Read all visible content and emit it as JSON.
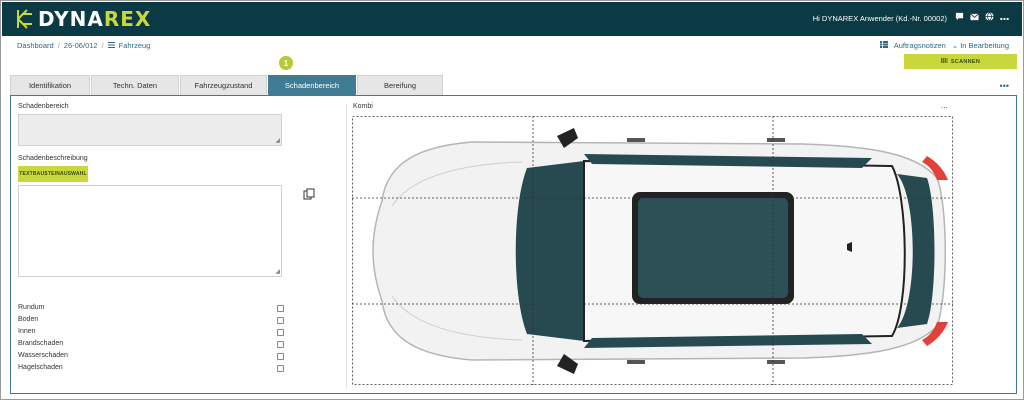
{
  "header": {
    "logo_prefix": "DYNA",
    "logo_accent": "REX",
    "greeting": "Hi DYNAREX Anwender (Kd.-Nr. 00002)",
    "icons": [
      "chat-icon",
      "mail-icon",
      "globe-icon",
      "more-icon"
    ]
  },
  "breadcrumb": {
    "home": "Dashboard",
    "order": "26-06/012",
    "current": "Fahrzeug"
  },
  "status": {
    "notes": "Auftragsnotizen",
    "state": "In Bearbeitung"
  },
  "scan_button": "SCANNEN",
  "step_badge": "1",
  "tabs": [
    {
      "label": "Identifikation",
      "active": false
    },
    {
      "label": "Techn. Daten",
      "active": false
    },
    {
      "label": "Fahrzeugzustand",
      "active": false
    },
    {
      "label": "Schadenbereich",
      "active": true
    },
    {
      "label": "Bereifung",
      "active": false
    }
  ],
  "form": {
    "schadenbereich_label": "Schadenbereich",
    "schadenbereich_value": "",
    "beschreibung_label": "Schadenbeschreibung",
    "textbaustein_button": "TEXTBAUSTEINAUSWAHL",
    "beschreibung_value": "",
    "checkboxes": [
      {
        "label": "Rundum",
        "checked": false
      },
      {
        "label": "Boden",
        "checked": false
      },
      {
        "label": "Innen",
        "checked": false
      },
      {
        "label": "Brandschaden",
        "checked": false
      },
      {
        "label": "Wasserschaden",
        "checked": false
      },
      {
        "label": "Hagelschaden",
        "checked": false
      }
    ]
  },
  "vehicle": {
    "type_label": "Kombi",
    "menu": "...",
    "grid_columns": 3,
    "grid_rows": 3
  },
  "colors": {
    "header_bg": "#0b3a44",
    "accent_green": "#c8d83c",
    "tab_active": "#3f7c93",
    "link_blue": "#2c6a8c"
  }
}
